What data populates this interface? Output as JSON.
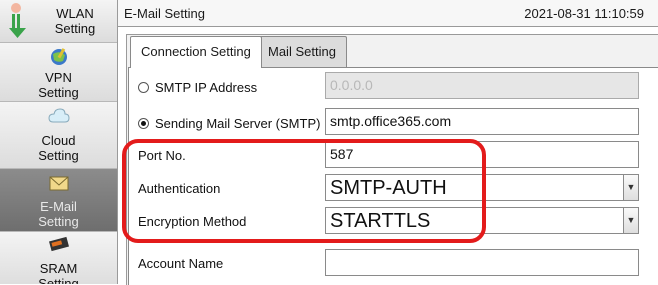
{
  "sidebar": {
    "items": [
      {
        "label_1": "WLAN",
        "label_2": "Setting",
        "icon": "wlan-icon"
      },
      {
        "label_1": "VPN",
        "label_2": "Setting",
        "icon": "vpn-icon"
      },
      {
        "label_1": "Cloud",
        "label_2": "Setting",
        "icon": "cloud-icon"
      },
      {
        "label_1": "E-Mail",
        "label_2": "Setting",
        "icon": "mail-icon"
      },
      {
        "label_1": "SRAM",
        "label_2": "Setting",
        "icon": "sram-icon"
      }
    ]
  },
  "header": {
    "title": "E-Mail Setting",
    "datetime": "2021-08-31 11:10:59"
  },
  "tabs": [
    {
      "label": "Connection Setting"
    },
    {
      "label": "Mail Setting"
    }
  ],
  "form": {
    "smtp_ip": {
      "label": "SMTP IP Address",
      "value": "0.0.0.0"
    },
    "smtp_server": {
      "label": "Sending Mail Server (SMTP)",
      "value": "smtp.office365.com"
    },
    "port": {
      "label": "Port No.",
      "value": "587"
    },
    "auth": {
      "label": "Authentication",
      "value": "SMTP-AUTH"
    },
    "encryption": {
      "label": "Encryption Method",
      "value": "STARTTLS"
    },
    "account": {
      "label": "Account Name",
      "value": ""
    }
  },
  "colors": {
    "highlight": "#e31b1b",
    "active_sidebar": "#7a7a7a"
  }
}
